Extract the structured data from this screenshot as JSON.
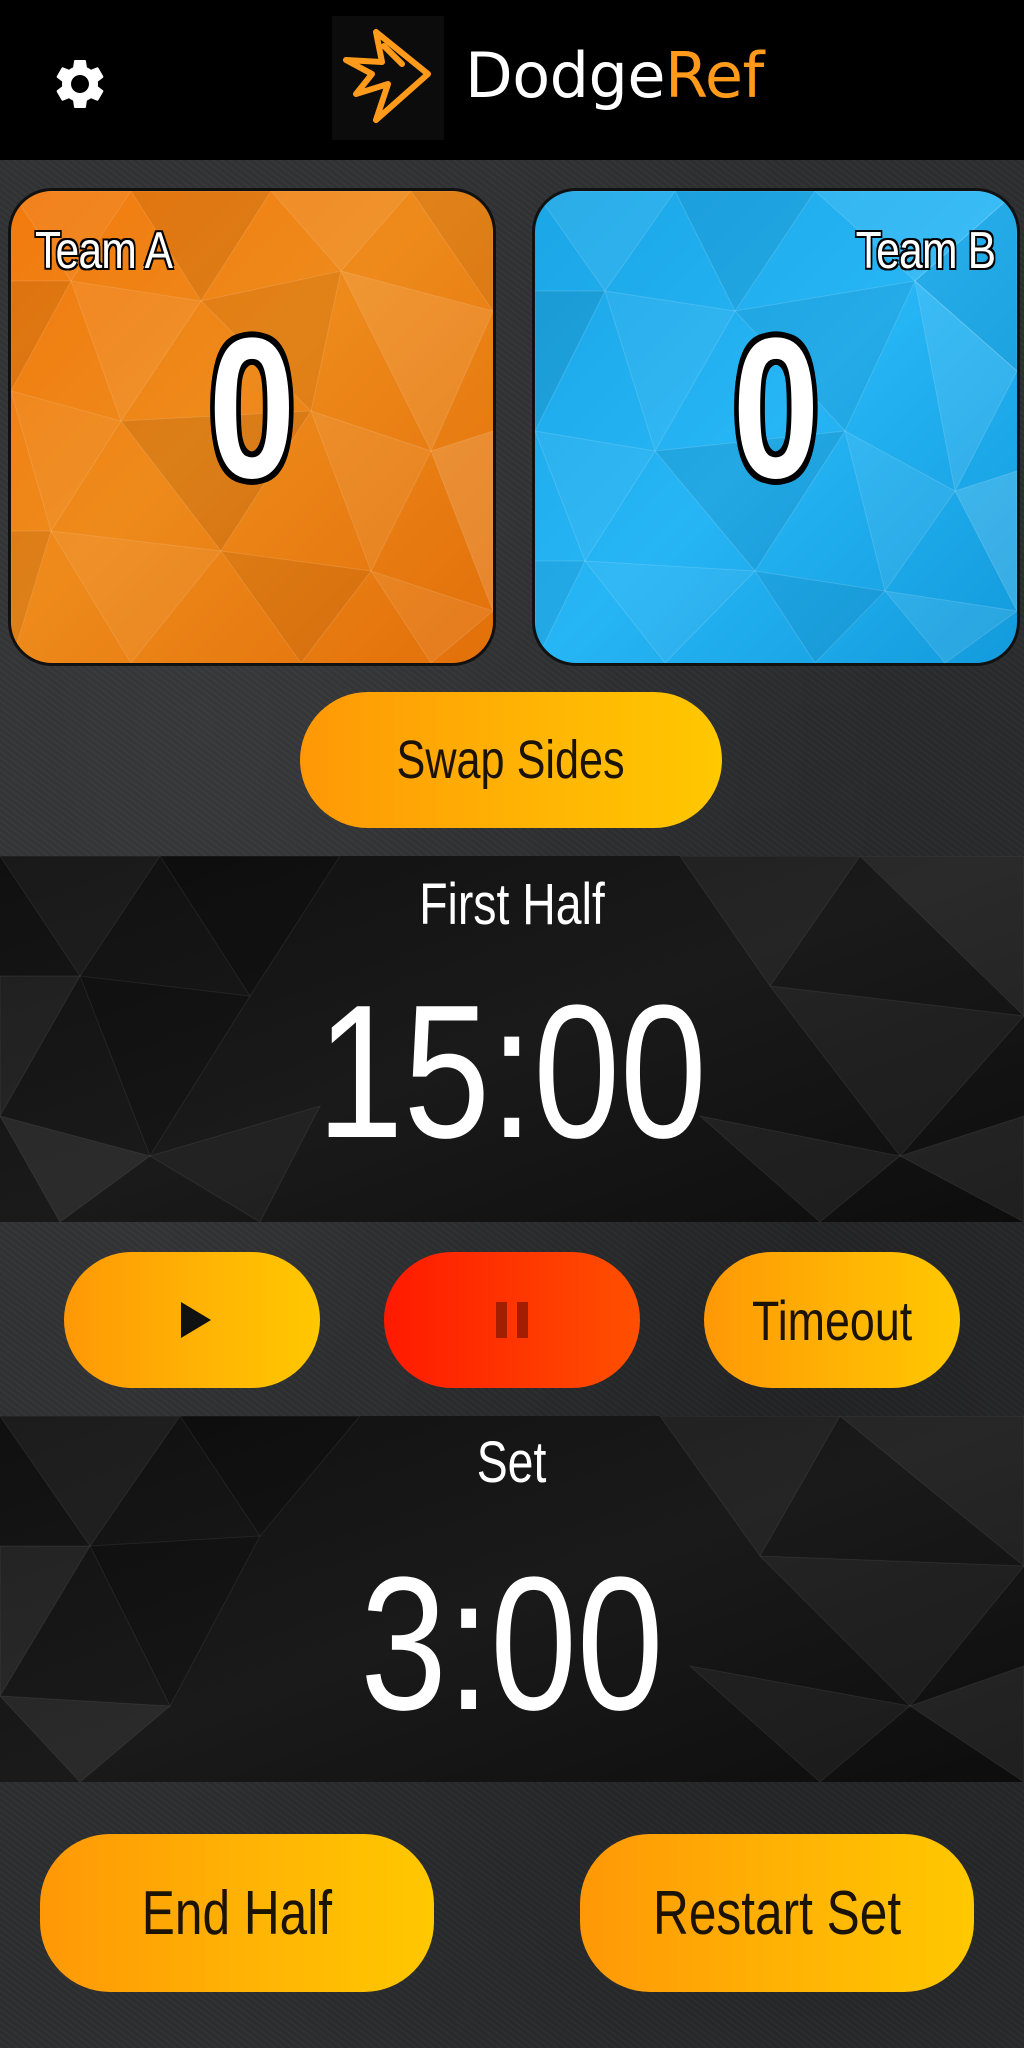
{
  "header": {
    "brand_primary": "Dodge",
    "brand_accent": "Ref",
    "brand_accent_color": "#ff9a1a",
    "settings_icon": "gear-icon",
    "logo_icon": "dodgeref-logo"
  },
  "teams": {
    "a": {
      "name": "Team A",
      "score": "0",
      "color": "#f27a0e"
    },
    "b": {
      "name": "Team B",
      "score": "0",
      "color": "#26b5f5"
    }
  },
  "swap_label": "Swap Sides",
  "game_clock": {
    "period": "First Half",
    "time": "15:00"
  },
  "controls": {
    "play_icon": "play-icon",
    "pause_icon": "pause-icon",
    "timeout_label": "Timeout"
  },
  "set_clock": {
    "label": "Set",
    "time": "3:00"
  },
  "actions": {
    "end_half": "End Half",
    "restart_set": "Restart Set"
  }
}
